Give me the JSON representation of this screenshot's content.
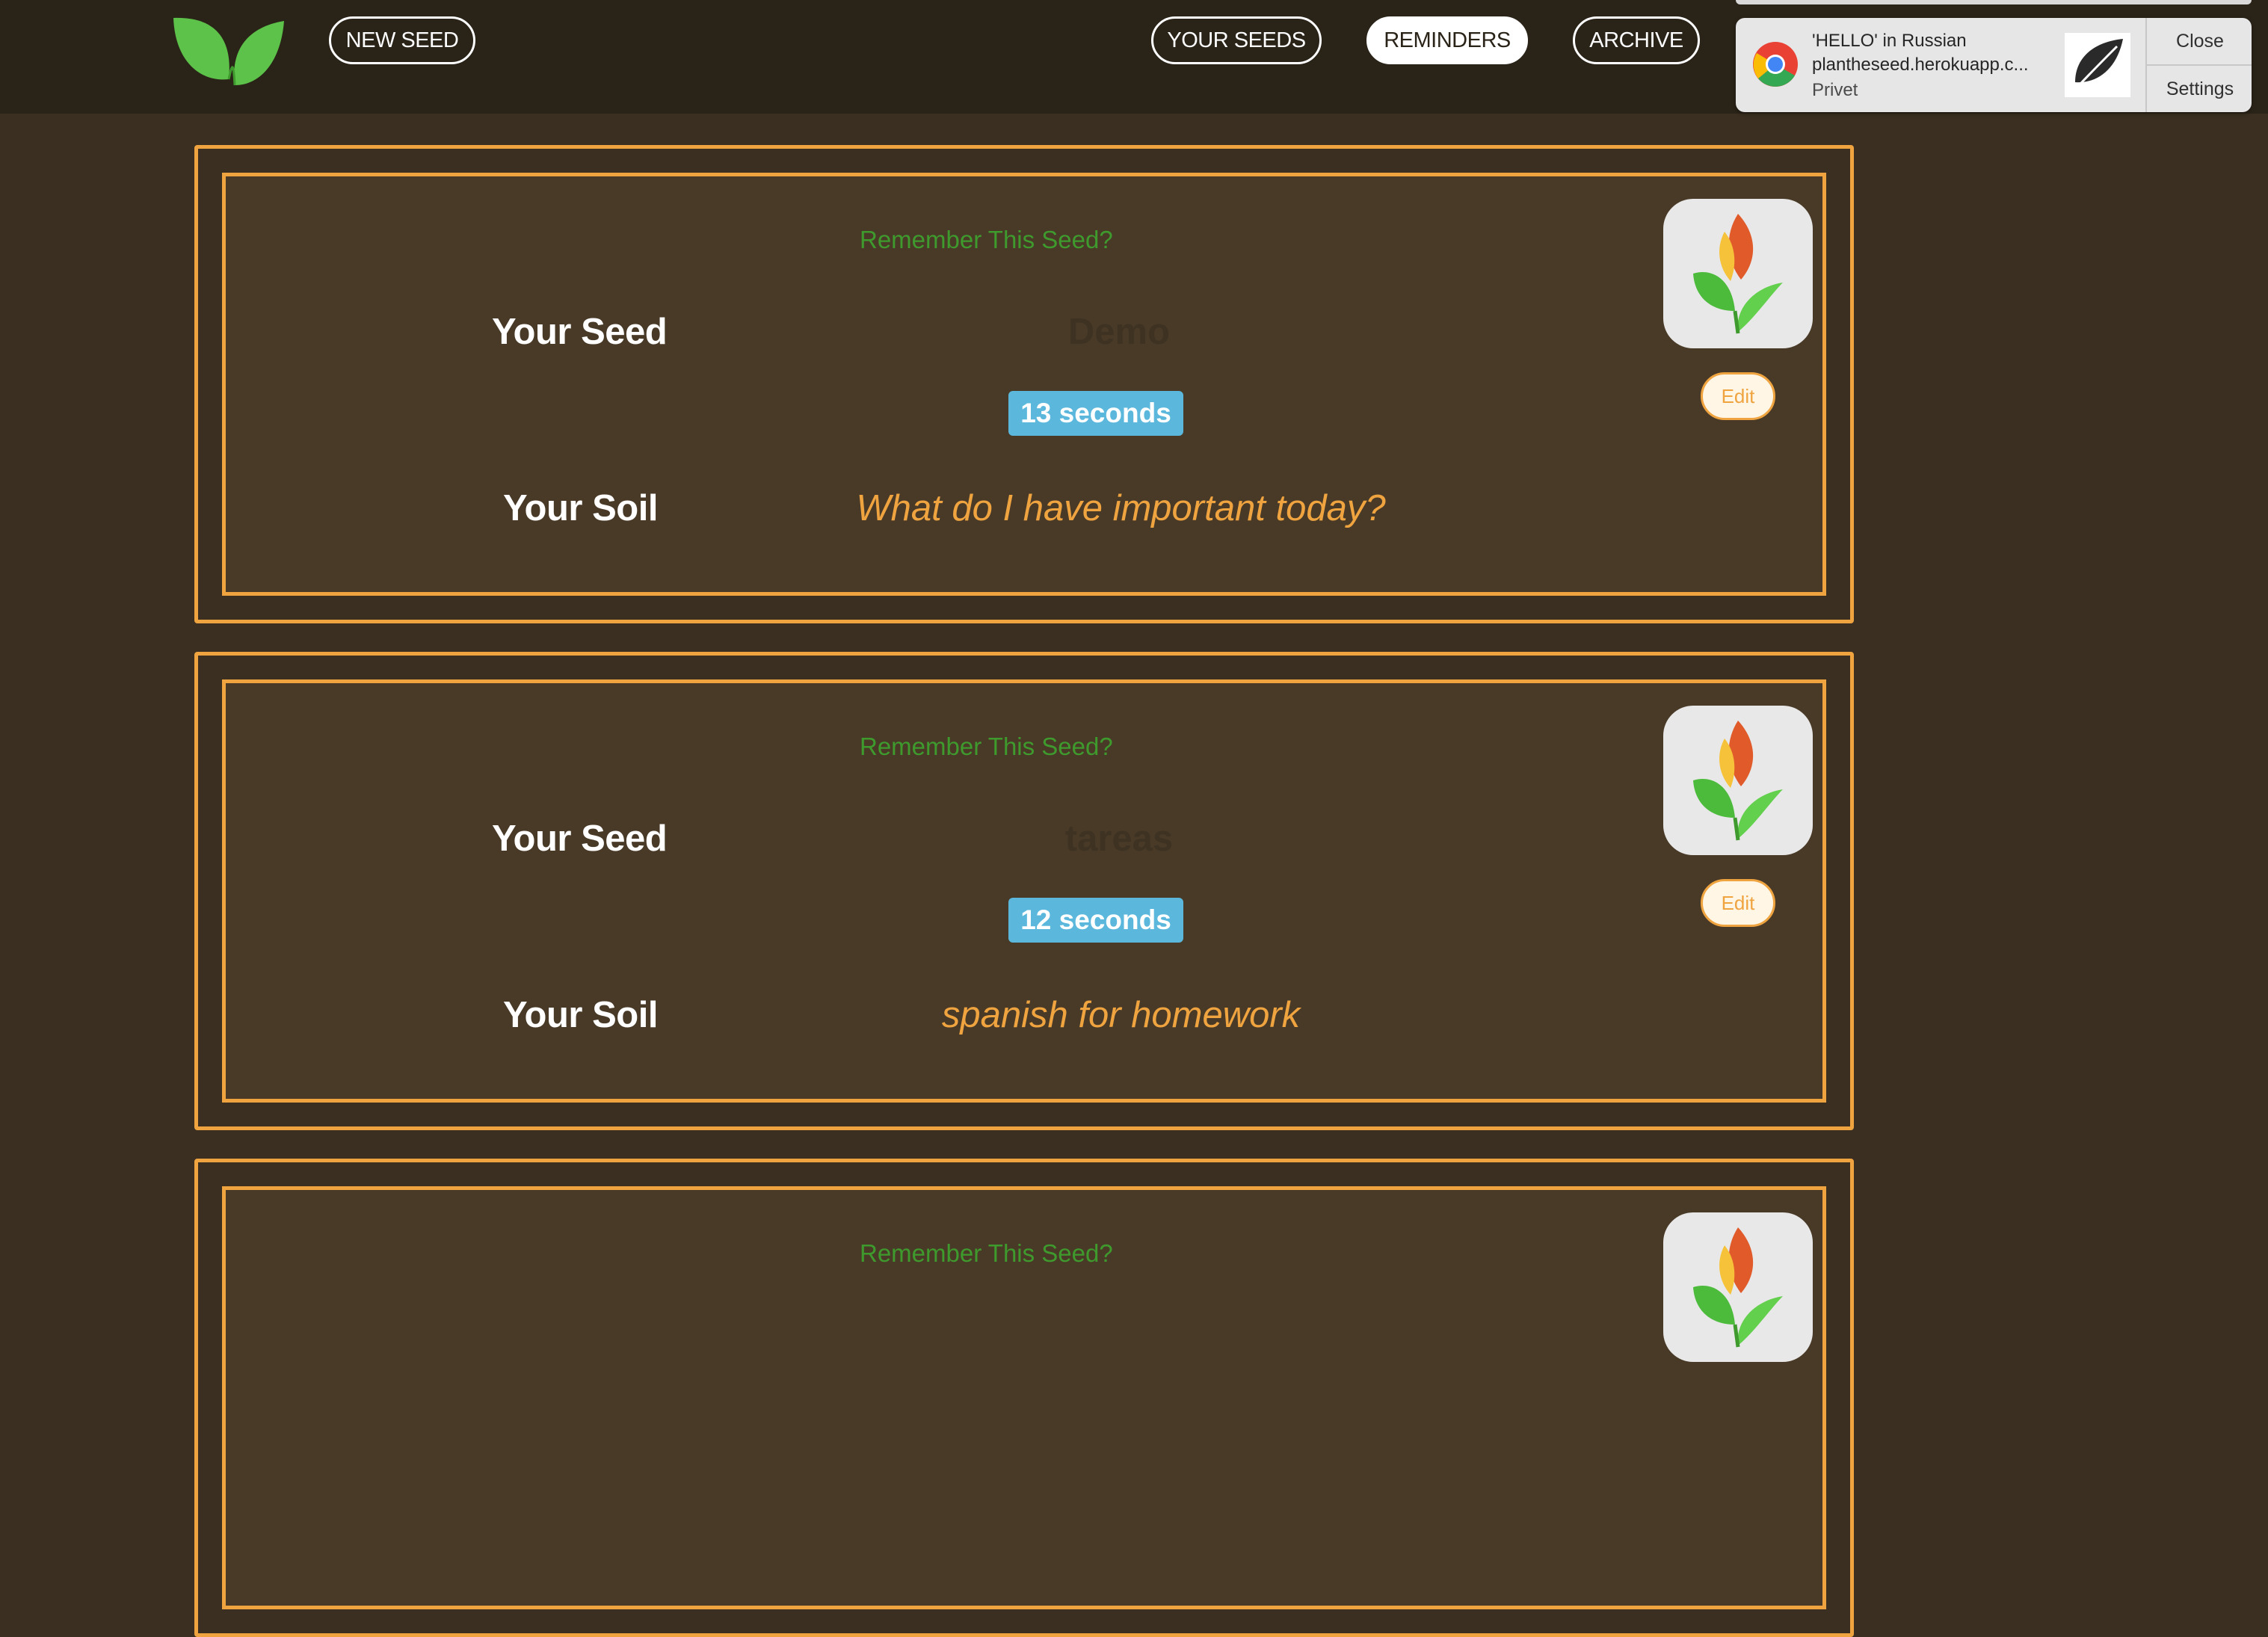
{
  "nav": {
    "new_seed": "NEW SEED",
    "your_seeds": "YOUR SEEDS",
    "reminders": "REMINDERS",
    "archive": "ARCHIVE",
    "active": "reminders"
  },
  "notification": {
    "title": "'HELLO' in Russian",
    "source": "plantheseed.herokuapp.c...",
    "body": "Privet",
    "close": "Close",
    "settings": "Settings"
  },
  "cards": [
    {
      "prompt": "Remember This Seed?",
      "seed_label": "Your Seed",
      "seed_value": "Demo",
      "timer": "13 seconds",
      "soil_label": "Your Soil",
      "soil_value": "What do I have important today?",
      "edit": "Edit"
    },
    {
      "prompt": "Remember This Seed?",
      "seed_label": "Your Seed",
      "seed_value": "tareas",
      "timer": "12 seconds",
      "soil_label": "Your Soil",
      "soil_value": "spanish for homework",
      "edit": "Edit"
    },
    {
      "prompt": "Remember This Seed?"
    }
  ],
  "colors": {
    "page_bg": "#3a2f20",
    "topbar_bg": "#2a2318",
    "card_bg": "#493a27",
    "accent": "#f0a440",
    "prompt_green": "#3f9a2e",
    "timer_blue": "#5bb8dc"
  }
}
